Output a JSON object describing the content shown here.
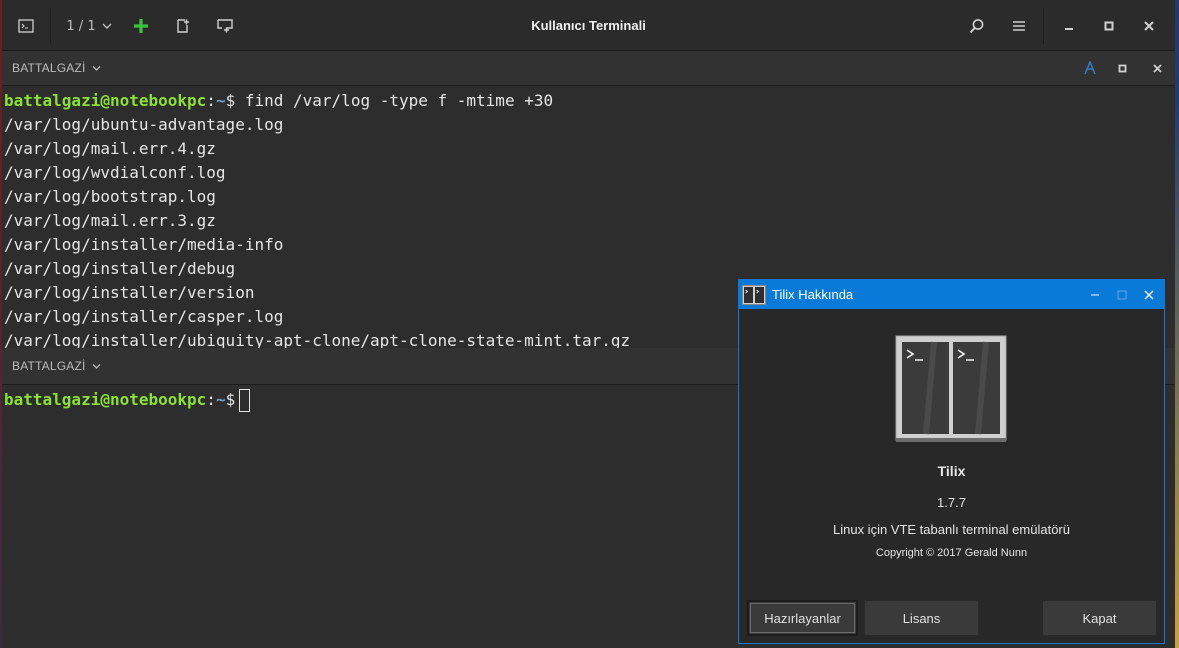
{
  "window": {
    "title": "Kullanıcı Terminali",
    "session_counter": "1 / 1"
  },
  "panes": [
    {
      "title": "BATTALGAZİ",
      "lines": [
        {
          "user": "battalgazi@notebookpc",
          "sep": ":",
          "path": "~",
          "prompt": "$",
          "cmd": " find /var/log -type f -mtime +30"
        },
        {
          "text": "/var/log/ubuntu-advantage.log"
        },
        {
          "text": "/var/log/mail.err.4.gz"
        },
        {
          "text": "/var/log/wvdialconf.log"
        },
        {
          "text": "/var/log/bootstrap.log"
        },
        {
          "text": "/var/log/mail.err.3.gz"
        },
        {
          "text": "/var/log/installer/media-info"
        },
        {
          "text": "/var/log/installer/debug"
        },
        {
          "text": "/var/log/installer/version"
        },
        {
          "text": "/var/log/installer/casper.log"
        },
        {
          "text": "/var/log/installer/ubiquity-apt-clone/apt-clone-state-mint.tar.gz"
        }
      ]
    },
    {
      "title": "BATTALGAZİ",
      "prompt": {
        "user": "battalgazi@notebookpc",
        "sep": ":",
        "path": "~",
        "prompt": "$"
      }
    }
  ],
  "about_dialog": {
    "window_title": "Tilix Hakkında",
    "app_name": "Tilix",
    "version": "1.7.7",
    "description": "Linux için VTE tabanlı terminal emülatörü",
    "copyright": "Copyright © 2017 Gerald Nunn",
    "buttons": {
      "credits": "Hazırlayanlar",
      "license": "Lisans",
      "close": "Kapat"
    }
  },
  "colors": {
    "user": "#8ae234",
    "path": "#729fcf",
    "accent": "#0a7ad8",
    "add": "#3cc13c"
  },
  "icons": {
    "sidebar": "sidebar-toggle-icon",
    "add": "plus-icon",
    "split_right": "split-right-icon",
    "split_down": "split-down-icon",
    "search": "search-icon",
    "menu": "hamburger-icon",
    "minimize": "minimize-icon",
    "maximize": "maximize-icon",
    "close": "close-icon"
  }
}
